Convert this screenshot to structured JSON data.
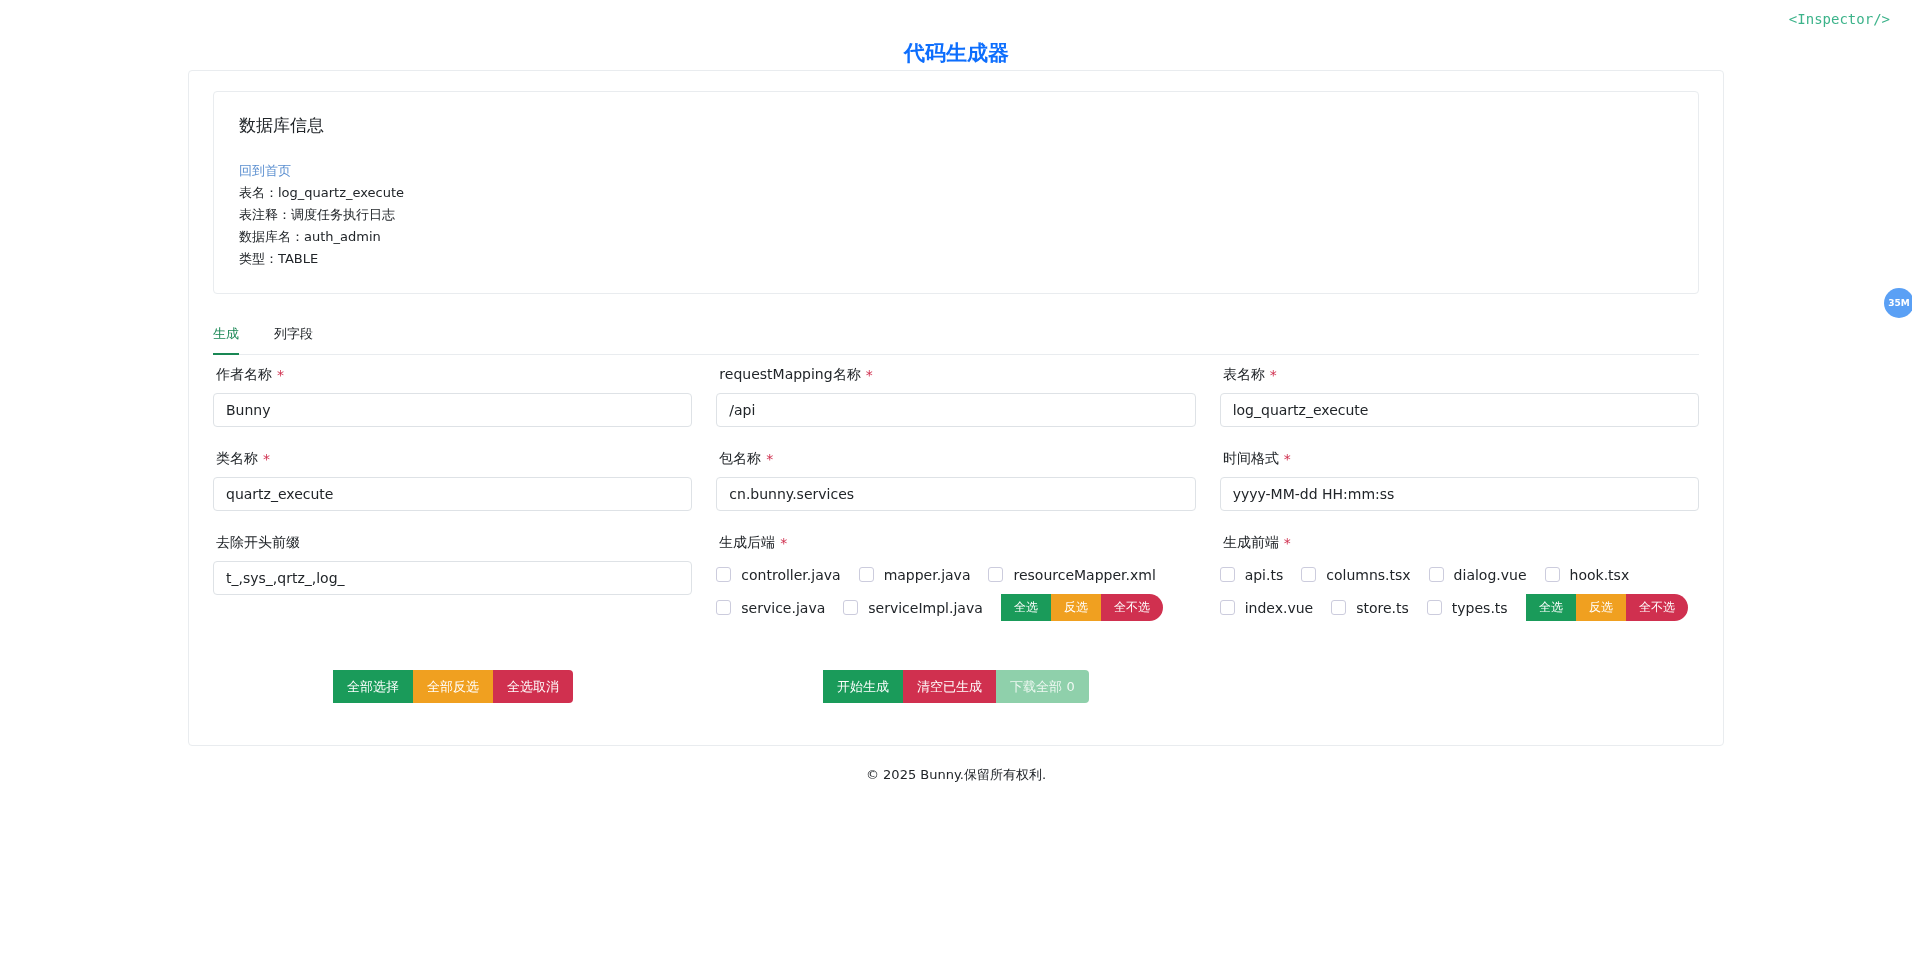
{
  "page_title": "代码生成器",
  "inspector_label": "<Inspector/>",
  "memory_badge": "35M",
  "db_info": {
    "title": "数据库信息",
    "home_link": "回到首页",
    "lines": [
      "表名：log_quartz_execute",
      "表注释：调度任务执行日志",
      "数据库名：auth_admin",
      "类型：TABLE"
    ]
  },
  "tabs": [
    {
      "label": "生成",
      "selected": true
    },
    {
      "label": "列字段",
      "selected": false
    }
  ],
  "fields": [
    {
      "kind": "input",
      "label": "作者名称",
      "required_mark": "*",
      "value": "Bunny"
    },
    {
      "kind": "input",
      "label": "requestMapping名称",
      "required_mark": "*",
      "value": "/api"
    },
    {
      "kind": "input",
      "label": "表名称",
      "required_mark": "*",
      "value": "log_quartz_execute"
    },
    {
      "kind": "input",
      "label": "类名称",
      "required_mark": "*",
      "value": "quartz_execute"
    },
    {
      "kind": "input",
      "label": "包名称",
      "required_mark": "*",
      "value": "cn.bunny.services"
    },
    {
      "kind": "input",
      "label": "时间格式",
      "required_mark": "*",
      "value": "yyyy-MM-dd HH:mm:ss"
    },
    {
      "kind": "input",
      "label": "去除开头前缀",
      "value": "t_,sys_,qrtz_,log_"
    },
    {
      "kind": "checks",
      "label": "生成后端",
      "required_mark": "*",
      "options": [
        {
          "label": "controller.java",
          "checked": false
        },
        {
          "label": "mapper.java",
          "checked": false
        },
        {
          "label": "resourceMapper.xml",
          "checked": false
        },
        {
          "label": "service.java",
          "checked": false
        },
        {
          "label": "serviceImpl.java",
          "checked": false
        }
      ],
      "actions": [
        {
          "label": "全选",
          "color": "#1a9b5a"
        },
        {
          "label": "反选",
          "color": "#f0a020"
        },
        {
          "label": "全不选",
          "color": "#d0304f"
        }
      ]
    },
    {
      "kind": "checks",
      "label": "生成前端",
      "required_mark": "*",
      "options": [
        {
          "label": "api.ts",
          "checked": false
        },
        {
          "label": "columns.tsx",
          "checked": false
        },
        {
          "label": "dialog.vue",
          "checked": false
        },
        {
          "label": "hook.tsx",
          "checked": false
        },
        {
          "label": "index.vue",
          "checked": false
        },
        {
          "label": "store.ts",
          "checked": false
        },
        {
          "label": "types.ts",
          "checked": false
        }
      ],
      "actions": [
        {
          "label": "全选",
          "color": "#1a9b5a"
        },
        {
          "label": "反选",
          "color": "#f0a020"
        },
        {
          "label": "全不选",
          "color": "#d0304f"
        }
      ]
    }
  ],
  "action_groups": [
    [
      {
        "label": "全部选择",
        "color": "#1a9b5a",
        "disabled": false
      },
      {
        "label": "全部反选",
        "color": "#f0a020",
        "disabled": false
      },
      {
        "label": "全选取消",
        "color": "#d0304f",
        "disabled": false
      }
    ],
    [
      {
        "label": "开始生成",
        "color": "#1a9b5a",
        "disabled": false
      },
      {
        "label": "清空已生成",
        "color": "#d0304f",
        "disabled": false
      },
      {
        "label": "下载全部 0",
        "color": "#8fd0ab",
        "disabled": true
      }
    ]
  ],
  "footer": "© 2025 Bunny.保留所有权利."
}
